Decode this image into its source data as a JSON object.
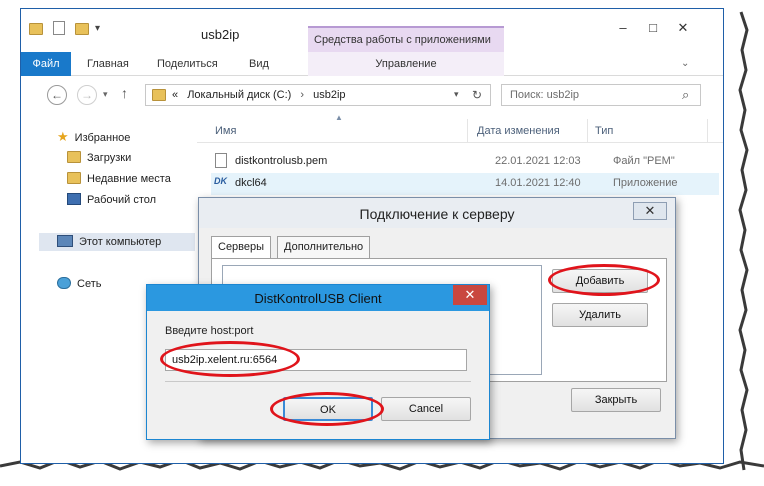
{
  "explorer": {
    "title": "usb2ip",
    "context_group": "Средства работы с приложениями",
    "ribbon_tabs": [
      "Файл",
      "Главная",
      "Поделиться",
      "Вид",
      "Управление"
    ],
    "address": {
      "prefix": "«",
      "drive": "Локальный диск (C:)",
      "folder": "usb2ip"
    },
    "search_placeholder": "Поиск: usb2ip",
    "nav": {
      "favorites": "Избранное",
      "downloads": "Загрузки",
      "recent": "Недавние места",
      "desktop": "Рабочий стол",
      "computer": "Этот компьютер",
      "network": "Сеть"
    },
    "columns": {
      "name": "Имя",
      "modified": "Дата изменения",
      "type": "Тип"
    },
    "files": [
      {
        "name": "distkontrolusb.pem",
        "modified": "22.01.2021 12:03",
        "type": "Файл \"PEM\""
      },
      {
        "name": "dkcl64",
        "modified": "14.01.2021 12:40",
        "type": "Приложение"
      }
    ]
  },
  "connect_dialog": {
    "title": "Подключение к серверу",
    "tabs": [
      "Серверы",
      "Дополнительно"
    ],
    "add_label": "Добавить",
    "delete_label": "Удалить",
    "close_label": "Закрыть"
  },
  "client_dialog": {
    "title": "DistKontrolUSB Client",
    "prompt": "Введите host:port",
    "input_value": "usb2ip.xelent.ru:6564",
    "ok_label": "OK",
    "cancel_label": "Cancel"
  },
  "colors": {
    "file_tab": "#1979ca",
    "context_tab": "#e8d9f1",
    "client_titlebar": "#2b98e0",
    "close_red": "#c9473f",
    "annotation": "#e0141b"
  }
}
